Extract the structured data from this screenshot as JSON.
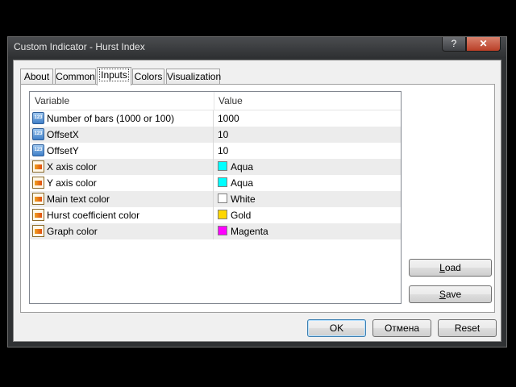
{
  "window": {
    "title": "Custom Indicator - Hurst Index",
    "help_glyph": "?",
    "close_glyph": "✕"
  },
  "tabs": [
    {
      "label": "About",
      "active": false
    },
    {
      "label": "Common",
      "active": false
    },
    {
      "label": "Inputs",
      "active": true
    },
    {
      "label": "Colors",
      "active": false
    },
    {
      "label": "Visualization",
      "active": false
    }
  ],
  "grid": {
    "columns": [
      "Variable",
      "Value"
    ],
    "rows": [
      {
        "icon": "numeric-input-icon",
        "variable": "Number of bars (1000 or 100)",
        "value": "1000"
      },
      {
        "icon": "numeric-input-icon",
        "variable": "OffsetX",
        "value": "10"
      },
      {
        "icon": "numeric-input-icon",
        "variable": "OffsetY",
        "value": "10"
      },
      {
        "icon": "color-input-icon",
        "variable": "X axis color",
        "value": "Aqua",
        "color": "#00ffff"
      },
      {
        "icon": "color-input-icon",
        "variable": "Y axis color",
        "value": "Aqua",
        "color": "#00ffff"
      },
      {
        "icon": "color-input-icon",
        "variable": "Main text color",
        "value": "White",
        "color": "#ffffff"
      },
      {
        "icon": "color-input-icon",
        "variable": "Hurst coefficient color",
        "value": "Gold",
        "color": "#ffd700"
      },
      {
        "icon": "color-input-icon",
        "variable": "Graph color",
        "value": "Magenta",
        "color": "#ff00ff"
      }
    ]
  },
  "side_buttons": {
    "load": {
      "hotkey": "L",
      "rest": "oad"
    },
    "save": {
      "hotkey": "S",
      "rest": "ave"
    }
  },
  "footer_buttons": {
    "ok": "OK",
    "cancel": "Отмена",
    "reset": "Reset"
  }
}
